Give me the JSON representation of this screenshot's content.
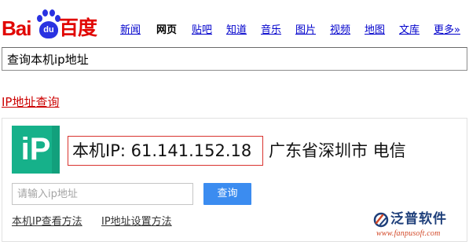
{
  "logo": {
    "left_text": "Bai",
    "paw_text": "du",
    "right_text": "百度"
  },
  "nav": {
    "items": [
      {
        "label": "新闻"
      },
      {
        "label": "网页"
      },
      {
        "label": "贴吧"
      },
      {
        "label": "知道"
      },
      {
        "label": "音乐"
      },
      {
        "label": "图片"
      },
      {
        "label": "视频"
      },
      {
        "label": "地图"
      },
      {
        "label": "文库"
      },
      {
        "label": "更多»"
      }
    ],
    "active": "网页"
  },
  "search": {
    "value": "查询本机ip地址"
  },
  "result": {
    "title": "IP地址查询",
    "logo_text": "iP",
    "ip_line": "本机IP: 61.141.152.18",
    "location": "广东省深圳市 电信",
    "input_placeholder": "请输入ip地址",
    "query_button": "查询",
    "links": [
      {
        "label": "本机IP查看方法"
      },
      {
        "label": "IP地址设置方法"
      }
    ]
  },
  "watermark": {
    "name": "泛普软件",
    "url": "www.fanpusoft.com"
  },
  "colors": {
    "brand_red": "#e10602",
    "brand_blue": "#2932e1",
    "link_blue": "#0000cc",
    "ip_logo_green": "#16b18a",
    "button_blue": "#3b8cf0",
    "highlight_red": "#d9332e"
  }
}
